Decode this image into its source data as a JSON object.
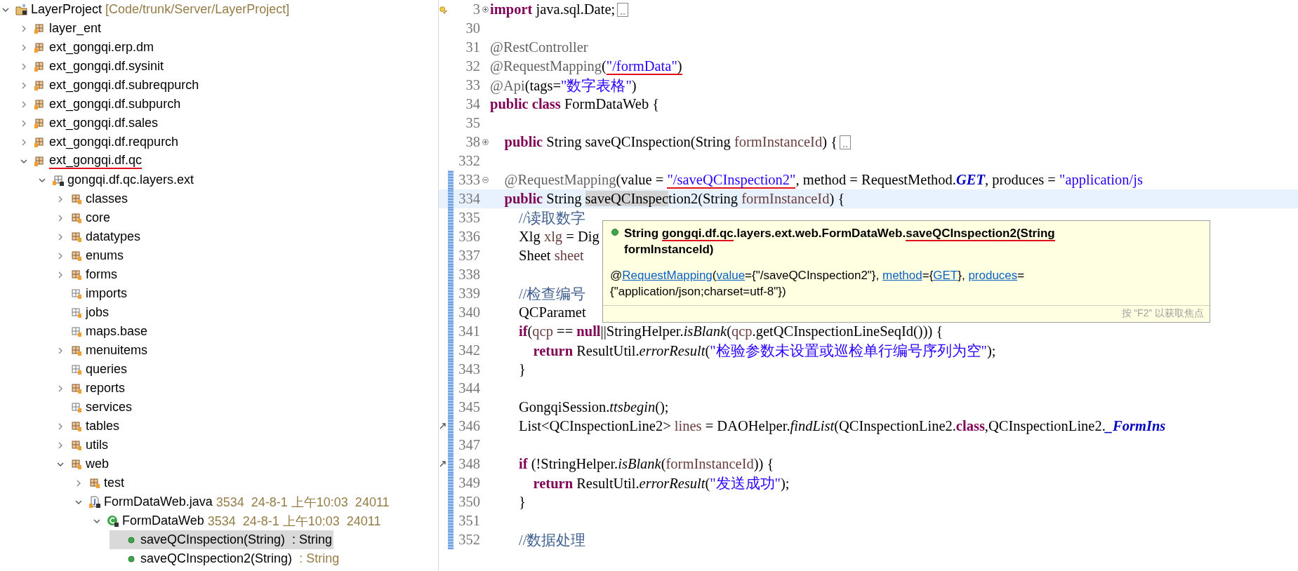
{
  "tree": {
    "items": [
      {
        "label": "LayerProject",
        "decoration": "[Code/trunk/Server/LayerProject]",
        "kind": "project",
        "expanded": true,
        "selected": false,
        "marked": false,
        "children": [
          {
            "label": "layer_ent",
            "kind": "package-project",
            "expanded": false,
            "selected": false,
            "marked": false
          },
          {
            "label": "ext_gongqi.erp.dm",
            "kind": "package-project",
            "expanded": false,
            "selected": false,
            "marked": false
          },
          {
            "label": "ext_gongqi.df.sysinit",
            "kind": "package-project",
            "expanded": false,
            "selected": false,
            "marked": false
          },
          {
            "label": "ext_gongqi.df.subreqpurch",
            "kind": "package-project",
            "expanded": false,
            "selected": false,
            "marked": false
          },
          {
            "label": "ext_gongqi.df.subpurch",
            "kind": "package-project",
            "expanded": false,
            "selected": false,
            "marked": false
          },
          {
            "label": "ext_gongqi.df.sales",
            "kind": "package-project",
            "expanded": false,
            "selected": false,
            "marked": false
          },
          {
            "label": "ext_gongqi.df.reqpurch",
            "kind": "package-project",
            "expanded": false,
            "selected": false,
            "marked": false
          },
          {
            "label": "ext_gongqi.df.qc",
            "kind": "package-project",
            "expanded": true,
            "selected": false,
            "marked": true,
            "children": [
              {
                "label": "gongqi.df.qc.layers.ext",
                "kind": "source-folder",
                "expanded": true,
                "selected": false,
                "marked": false,
                "children": [
                  {
                    "label": "classes",
                    "kind": "package",
                    "expanded": false,
                    "selected": false,
                    "marked": false
                  },
                  {
                    "label": "core",
                    "kind": "package",
                    "expanded": false,
                    "selected": false,
                    "marked": false
                  },
                  {
                    "label": "datatypes",
                    "kind": "package",
                    "expanded": false,
                    "selected": false,
                    "marked": false
                  },
                  {
                    "label": "enums",
                    "kind": "package",
                    "expanded": false,
                    "selected": false,
                    "marked": false
                  },
                  {
                    "label": "forms",
                    "kind": "package",
                    "expanded": false,
                    "selected": false,
                    "marked": false
                  },
                  {
                    "label": "imports",
                    "kind": "empty-package",
                    "selected": false,
                    "marked": false
                  },
                  {
                    "label": "jobs",
                    "kind": "empty-package",
                    "selected": false,
                    "marked": false
                  },
                  {
                    "label": "maps.base",
                    "kind": "empty-package",
                    "selected": false,
                    "marked": false
                  },
                  {
                    "label": "menuitems",
                    "kind": "package",
                    "expanded": false,
                    "selected": false,
                    "marked": false
                  },
                  {
                    "label": "queries",
                    "kind": "empty-package",
                    "selected": false,
                    "marked": false
                  },
                  {
                    "label": "reports",
                    "kind": "package",
                    "expanded": false,
                    "selected": false,
                    "marked": false
                  },
                  {
                    "label": "services",
                    "kind": "empty-package",
                    "selected": false,
                    "marked": false
                  },
                  {
                    "label": "tables",
                    "kind": "package",
                    "expanded": false,
                    "selected": false,
                    "marked": false
                  },
                  {
                    "label": "utils",
                    "kind": "package",
                    "expanded": false,
                    "selected": false,
                    "marked": false
                  },
                  {
                    "label": "web",
                    "kind": "package",
                    "expanded": true,
                    "selected": false,
                    "marked": false,
                    "children": [
                      {
                        "label": "test",
                        "kind": "package",
                        "expanded": false,
                        "selected": false,
                        "marked": false
                      },
                      {
                        "label": "FormDataWeb.java",
                        "decoration": "3534  24-8-1 上午10:03  24011",
                        "kind": "java-file",
                        "expanded": true,
                        "selected": false,
                        "marked": false,
                        "children": [
                          {
                            "label": "FormDataWeb",
                            "decoration": "3534  24-8-1 上午10:03  24011",
                            "kind": "class",
                            "expanded": true,
                            "selected": false,
                            "marked": false,
                            "children": [
                              {
                                "label": "saveQCInspection(String)",
                                "decoration": " : String",
                                "kind": "method",
                                "selected": true,
                                "marked": false
                              },
                              {
                                "label": "saveQCInspection2(String)",
                                "decoration": " : String",
                                "kind": "method",
                                "selected": false,
                                "marked": false
                              }
                            ]
                          }
                        ]
                      }
                    ]
                  }
                ]
              }
            ]
          }
        ]
      }
    ]
  },
  "editor": {
    "lines": [
      {
        "number": "3",
        "gutter": {
          "kind": "warning"
        },
        "changed": false,
        "current": false,
        "folded": true,
        "segments": [
          {
            "kind": "kw",
            "text": "import"
          },
          {
            "kind": "plain",
            "text": " java.sql.Date;"
          }
        ]
      },
      {
        "number": "30",
        "changed": false,
        "current": false
      },
      {
        "number": "31",
        "changed": false,
        "current": false,
        "segments": [
          {
            "kind": "ann",
            "text": "@RestController"
          }
        ]
      },
      {
        "number": "32",
        "changed": false,
        "current": false,
        "segments": [
          {
            "kind": "ann",
            "text": "@RequestMapping"
          },
          {
            "kind": "plain",
            "text": "("
          },
          {
            "kind": "str",
            "text": "\"/formData\"",
            "marked": true
          },
          {
            "kind": "plain",
            "text": ")",
            "marked": true
          }
        ]
      },
      {
        "number": "33",
        "changed": false,
        "current": false,
        "segments": [
          {
            "kind": "ann",
            "text": "@Api"
          },
          {
            "kind": "plain",
            "text": "(tags="
          },
          {
            "kind": "str",
            "text": "\"数字表格\""
          },
          {
            "kind": "plain",
            "text": ")"
          }
        ]
      },
      {
        "number": "34",
        "changed": false,
        "current": false,
        "segments": [
          {
            "kind": "kw",
            "text": "public class"
          },
          {
            "kind": "plain",
            "text": " FormDataWeb {"
          }
        ]
      },
      {
        "number": "35",
        "changed": false,
        "current": false
      },
      {
        "number": "38",
        "changed": false,
        "current": false,
        "folded": true,
        "segments": [
          {
            "kind": "kw",
            "text": "    public"
          },
          {
            "kind": "plain",
            "text": " String saveQCInspection(String "
          },
          {
            "kind": "var",
            "text": "formInstanceId"
          },
          {
            "kind": "plain",
            "text": ") {"
          }
        ]
      },
      {
        "number": "332",
        "changed": false,
        "current": false
      },
      {
        "number": "333",
        "changed": true,
        "current": false,
        "folded": false,
        "segments": [
          {
            "kind": "ann",
            "text": "    @RequestMapping"
          },
          {
            "kind": "plain",
            "text": "(value = "
          },
          {
            "kind": "str",
            "text": "\"/saveQCInspection2\"",
            "marked": true
          },
          {
            "kind": "plain",
            "text": ", method = RequestMethod."
          },
          {
            "kind": "const",
            "text": "GET"
          },
          {
            "kind": "plain",
            "text": ", produces = "
          },
          {
            "kind": "str",
            "text": "\"application/js"
          }
        ]
      },
      {
        "number": "334",
        "changed": true,
        "current": true,
        "segments": [
          {
            "kind": "kw",
            "text": "    public"
          },
          {
            "kind": "plain",
            "text": " String "
          },
          {
            "kind": "plain",
            "text": "saveQCInspec",
            "highlight": true
          },
          {
            "kind": "plain",
            "text": "tion2(String "
          },
          {
            "kind": "var",
            "text": "formInstanceId"
          },
          {
            "kind": "plain",
            "text": ") {"
          }
        ]
      },
      {
        "number": "335",
        "changed": true,
        "current": false,
        "segments": [
          {
            "kind": "comment",
            "text": "        //读取数字"
          }
        ]
      },
      {
        "number": "336",
        "changed": true,
        "current": false,
        "segments": [
          {
            "kind": "plain",
            "text": "        Xlg "
          },
          {
            "kind": "var",
            "text": "xlg"
          },
          {
            "kind": "plain",
            "text": " = Dig"
          }
        ]
      },
      {
        "number": "337",
        "changed": true,
        "current": false,
        "segments": [
          {
            "kind": "plain",
            "text": "        Sheet "
          },
          {
            "kind": "var",
            "text": "sheet"
          }
        ]
      },
      {
        "number": "338",
        "changed": true,
        "current": false
      },
      {
        "number": "339",
        "changed": true,
        "current": false,
        "segments": [
          {
            "kind": "comment",
            "text": "        //检查编号"
          }
        ]
      },
      {
        "number": "340",
        "changed": true,
        "current": false,
        "segments": [
          {
            "kind": "plain",
            "text": "        QCParamet"
          }
        ]
      },
      {
        "number": "341",
        "changed": true,
        "current": false,
        "segments": [
          {
            "kind": "kw",
            "text": "        if"
          },
          {
            "kind": "plain",
            "text": "("
          },
          {
            "kind": "var",
            "text": "qcp"
          },
          {
            "kind": "plain",
            "text": " == "
          },
          {
            "kind": "kw",
            "text": "null"
          },
          {
            "kind": "plain",
            "text": "||StringHelper."
          },
          {
            "kind": "static",
            "text": "isBlank"
          },
          {
            "kind": "plain",
            "text": "("
          },
          {
            "kind": "var",
            "text": "qcp"
          },
          {
            "kind": "plain",
            "text": ".getQCInspectionLineSeqId())) {"
          }
        ]
      },
      {
        "number": "342",
        "changed": true,
        "current": false,
        "segments": [
          {
            "kind": "kw",
            "text": "            return"
          },
          {
            "kind": "plain",
            "text": " ResultUtil."
          },
          {
            "kind": "static",
            "text": "errorResult"
          },
          {
            "kind": "plain",
            "text": "("
          },
          {
            "kind": "str",
            "text": "\"检验参数未设置或巡检单行编号序列为空\""
          },
          {
            "kind": "plain",
            "text": ");"
          }
        ]
      },
      {
        "number": "343",
        "changed": true,
        "current": false,
        "segments": [
          {
            "kind": "plain",
            "text": "        }"
          }
        ]
      },
      {
        "number": "344",
        "changed": true,
        "current": false
      },
      {
        "number": "345",
        "changed": true,
        "current": false,
        "segments": [
          {
            "kind": "plain",
            "text": "        GongqiSession."
          },
          {
            "kind": "static",
            "text": "ttsbegin"
          },
          {
            "kind": "plain",
            "text": "();"
          }
        ]
      },
      {
        "number": "346",
        "gutter": {
          "kind": "override"
        },
        "changed": true,
        "current": false,
        "segments": [
          {
            "kind": "plain",
            "text": "        List<QCInspectionLine2> "
          },
          {
            "kind": "var",
            "text": "lines"
          },
          {
            "kind": "plain",
            "text": " = DAOHelper."
          },
          {
            "kind": "static",
            "text": "findList"
          },
          {
            "kind": "plain",
            "text": "(QCInspectionLine2."
          },
          {
            "kind": "kw",
            "text": "class"
          },
          {
            "kind": "plain",
            "text": ",QCInspectionLine2."
          },
          {
            "kind": "const",
            "text": "_FormIns"
          }
        ]
      },
      {
        "number": "347",
        "changed": true,
        "current": false
      },
      {
        "number": "348",
        "gutter": {
          "kind": "override"
        },
        "changed": true,
        "current": false,
        "segments": [
          {
            "kind": "kw",
            "text": "        if"
          },
          {
            "kind": "plain",
            "text": " (!StringHelper."
          },
          {
            "kind": "static",
            "text": "isBlank"
          },
          {
            "kind": "plain",
            "text": "("
          },
          {
            "kind": "var",
            "text": "formInstanceId"
          },
          {
            "kind": "plain",
            "text": ")) {"
          }
        ]
      },
      {
        "number": "349",
        "changed": true,
        "current": false,
        "segments": [
          {
            "kind": "kw",
            "text": "            return"
          },
          {
            "kind": "plain",
            "text": " ResultUtil."
          },
          {
            "kind": "static",
            "text": "errorResult"
          },
          {
            "kind": "plain",
            "text": "("
          },
          {
            "kind": "str",
            "text": "\"发送成功\""
          },
          {
            "kind": "plain",
            "text": ");"
          }
        ]
      },
      {
        "number": "350",
        "changed": true,
        "current": false,
        "segments": [
          {
            "kind": "plain",
            "text": "        }"
          }
        ]
      },
      {
        "number": "351",
        "changed": true,
        "current": false
      },
      {
        "number": "352",
        "changed": true,
        "current": false,
        "segments": [
          {
            "kind": "comment",
            "text": "        //数据处理"
          }
        ]
      }
    ]
  },
  "tooltip": {
    "signature_lines": [
      [
        {
          "text": "String ",
          "marked": false
        },
        {
          "text": "gongqi.df.qc",
          "marked": true
        },
        {
          "text": ".layers.ext.web.FormDataWeb.",
          "marked": false
        },
        {
          "text": "saveQCInspection2(String",
          "marked": true
        }
      ],
      [
        {
          "text": "formInstanceId)",
          "marked": false
        }
      ]
    ],
    "annotation_lines": [
      [
        {
          "kind": "text",
          "text": "@"
        },
        {
          "kind": "link",
          "text": "RequestMapping"
        },
        {
          "kind": "text",
          "text": "("
        },
        {
          "kind": "link",
          "text": "value"
        },
        {
          "kind": "text",
          "text": "={\"/saveQCInspection2\"}, "
        },
        {
          "kind": "link",
          "text": "method"
        },
        {
          "kind": "text",
          "text": "={"
        },
        {
          "kind": "link",
          "text": "GET"
        },
        {
          "kind": "text",
          "text": "}, "
        },
        {
          "kind": "link",
          "text": "produces"
        },
        {
          "kind": "text",
          "text": "="
        }
      ],
      [
        {
          "kind": "text",
          "text": "{\"application/json;charset=utf-8\"})"
        }
      ]
    ],
    "hint": "按 “F2” 以获取焦点"
  }
}
